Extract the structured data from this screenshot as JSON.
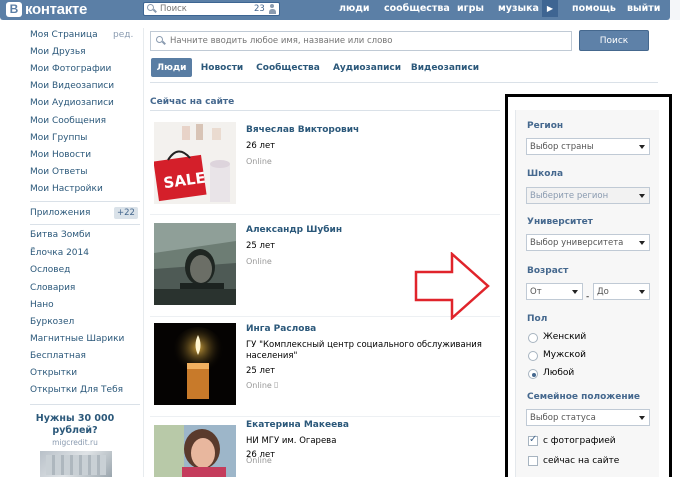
{
  "header": {
    "logo_mark": "B",
    "logo_text": "контакте",
    "search_placeholder": "Поиск",
    "search_count": "23",
    "nav": [
      "люди",
      "сообщества",
      "игры",
      "музыка",
      "помощь",
      "выйти"
    ]
  },
  "sidebar": {
    "items": [
      {
        "label": "Моя Страница"
      },
      {
        "label": "Мои Друзья"
      },
      {
        "label": "Мои Фотографии"
      },
      {
        "label": "Мои Видеозаписи"
      },
      {
        "label": "Мои Аудиозаписи"
      },
      {
        "label": "Мои Сообщения"
      },
      {
        "label": "Мои Группы"
      },
      {
        "label": "Мои Новости"
      },
      {
        "label": "Мои Ответы"
      },
      {
        "label": "Мои Настройки"
      }
    ],
    "edit_label": "ред.",
    "apps_label": "Приложения",
    "apps_badge": "+22",
    "apps": [
      "Битва Зомби",
      "Ёлочка 2014",
      "Ословед",
      "Словария",
      "Нано",
      "Буркозел",
      "Магнитные Шарики",
      "Бесплатная",
      "Открытки",
      "Открытки Для Тебя"
    ],
    "ad_title": "Нужны 30 000 рублей?",
    "ad_url": "migcredit.ru"
  },
  "search": {
    "placeholder": "Начните вводить любое имя, название или слово",
    "button_label": "Поиск"
  },
  "tabs": [
    "Люди",
    "Новости",
    "Сообщества",
    "Аудиозаписи",
    "Видеозаписи"
  ],
  "section_title": "Сейчас на сайте",
  "people": [
    {
      "name": "Вячеслав Викторович",
      "info": [
        "26 лет"
      ],
      "status": "Online"
    },
    {
      "name": "Александр Шубин",
      "info": [
        "25 лет"
      ],
      "status": "Online"
    },
    {
      "name": "Инга Раслова",
      "info": [
        "ГУ \"Комплексный центр социального обслуживания",
        "населения\"",
        "25 лет"
      ],
      "status": "Online"
    },
    {
      "name": "Екатерина Макеева",
      "info": [
        "НИ МГУ им. Огарева",
        "26 лет"
      ],
      "status": "Online"
    }
  ],
  "filters": {
    "region_label": "Регион",
    "region_value": "Выбор страны",
    "school_label": "Школа",
    "school_value": "Выберите регион",
    "university_label": "Университет",
    "university_value": "Выбор университета",
    "age_label": "Возраст",
    "age_from": "От",
    "age_to": "До",
    "age_dash": "-",
    "gender_label": "Пол",
    "gender_options": [
      "Женский",
      "Мужской",
      "Любой"
    ],
    "gender_selected": "Любой",
    "marital_label": "Семейное положение",
    "marital_value": "Выбор статуса",
    "with_photo_label": "с фотографией",
    "with_photo_checked": true,
    "online_now_label": "сейчас на сайте",
    "online_now_checked": false
  },
  "colors": {
    "header_bg": "#5b7fa6",
    "link": "#2b587a",
    "accent": "#45688e",
    "annotation_arrow": "#e0242b",
    "annotation_frame": "#000000"
  }
}
